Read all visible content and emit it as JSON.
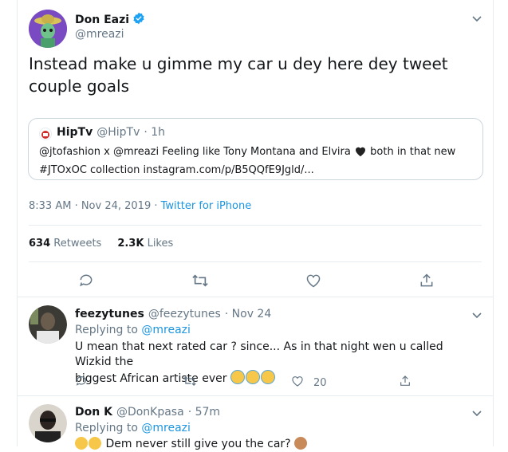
{
  "tweet": {
    "author_name": "Don Eazi",
    "handle": "@mreazi",
    "text": "Instead make u gimme my car u dey here dey tweet couple goals",
    "quote": {
      "name": "HipTv",
      "handle": "@HipTv",
      "time": "· 1h",
      "text": "@jtofashion x @mreazi  Feeling like Tony Montana and Elvira",
      "text2": "both in that new",
      "text3": "#JTOxOC collection instagram.com/p/B5QQfE9Jgld/..."
    },
    "timestamp": "8:33 AM · Nov 24, 2019 · ",
    "source": "Twitter for iPhone",
    "retweets_count": "634",
    "retweets_label": "Retweets",
    "likes_count": "2.3K",
    "likes_label": "Likes"
  },
  "replies": [
    {
      "name": "feezytunes",
      "handle": "@feezytunes",
      "time": "· Nov 24",
      "replying_label": "Replying to",
      "replying_handle": "@mreazi",
      "text_line1": "U mean that next rated car ? since... As in that night wen u called Wizkid the",
      "text_line2": "biggest African artiste ever",
      "like_count": "20"
    },
    {
      "name": "Don K",
      "handle": "@DonKpasa",
      "time": "· 57m",
      "replying_label": "Replying to",
      "replying_handle": "@mreazi",
      "text_line1": "Dem never still give you the car?"
    }
  ],
  "colors": {
    "accent": "#1b95e0",
    "muted": "#657786",
    "border": "#e6ecf0"
  }
}
